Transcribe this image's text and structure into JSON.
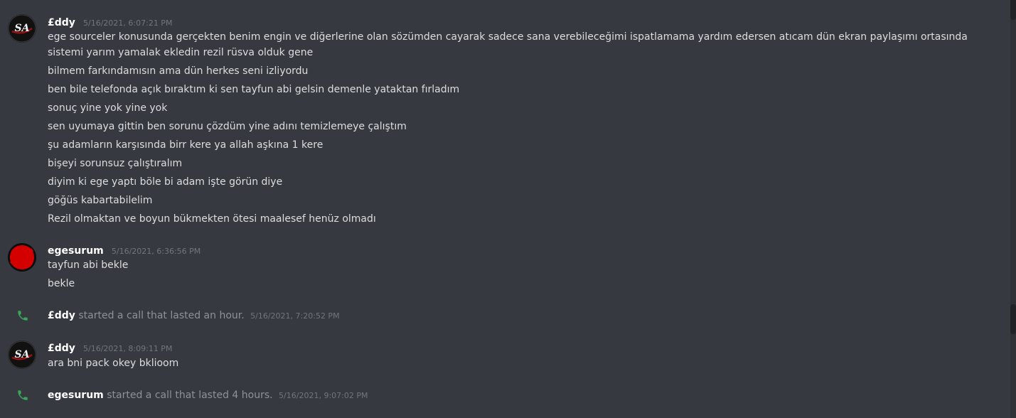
{
  "messages": [
    {
      "username": "£ddy",
      "timestamp": "5/16/2021, 6:07:21 PM",
      "avatar": "sa-logo-avatar",
      "lines": [
        "ege sourceler konusunda gerçekten benim engin ve diğerlerine olan sözümden cayarak sadece sana verebileceğimi ispatlamama yardım edersen atıcam dün ekran paylaşımı ortasında sistemi yarım yamalak ekledin rezil rüsva olduk gene",
        "bilmem farkındamısın ama dün herkes seni izliyordu",
        "ben bile telefonda açık bıraktım ki sen tayfun abi gelsin demenle yataktan fırladım",
        "sonuç yine yok yine yok",
        "sen uyumaya gittin ben sorunu çözdüm yine adını temizlemeye çalıştım",
        "şu adamların karşısında birr kere ya allah aşkına 1 kere",
        "bişeyi sorunsuz çalıştıralım",
        "diyim ki ege yaptı böle bi adam işte görün diye",
        "göğüs kabartabilelim",
        "Rezil olmaktan ve boyun bükmekten ötesi maalesef henüz olmadı"
      ]
    },
    {
      "username": "egesurum",
      "timestamp": "5/16/2021, 6:36:56 PM",
      "avatar": "red-circle-avatar",
      "lines": [
        "tayfun abi bekle",
        "bekle"
      ]
    },
    {
      "username": "£ddy",
      "timestamp": "5/16/2021, 8:09:11 PM",
      "avatar": "sa-logo-avatar",
      "lines": [
        "ara bni pack okey bklioom"
      ]
    }
  ],
  "calls": [
    {
      "username": "£ddy",
      "text": "started a call that lasted an hour.",
      "timestamp": "5/16/2021, 7:20:52 PM",
      "icon": "phone-icon"
    },
    {
      "username": "egesurum",
      "text": "started a call that lasted 4 hours.",
      "timestamp": "5/16/2021, 9:07:02 PM",
      "icon": "phone-icon"
    }
  ],
  "colors": {
    "background": "#36393f",
    "call_green": "#3ba55c"
  }
}
